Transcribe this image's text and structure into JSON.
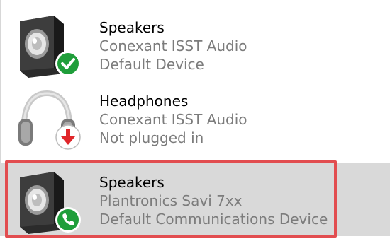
{
  "devices": [
    {
      "name": "Speakers",
      "driver": "Conexant ISST Audio",
      "status": "Default Device",
      "icon": "speaker-icon",
      "badge": "check-badge-icon",
      "selected": false
    },
    {
      "name": "Headphones",
      "driver": "Conexant ISST Audio",
      "status": "Not plugged in",
      "icon": "headphones-icon",
      "badge": "down-arrow-badge-icon",
      "selected": false
    },
    {
      "name": "Speakers",
      "driver": "Plantronics Savi 7xx",
      "status": "Default Communications Device",
      "icon": "speaker-icon",
      "badge": "phone-badge-icon",
      "selected": true
    }
  ],
  "colors": {
    "selection_bg": "#d9d9d9",
    "highlight_border": "#e24d50",
    "default_badge": "#1f9e3a",
    "unplugged_badge": "#e0262a",
    "secondary_text": "#7c7c7c"
  }
}
